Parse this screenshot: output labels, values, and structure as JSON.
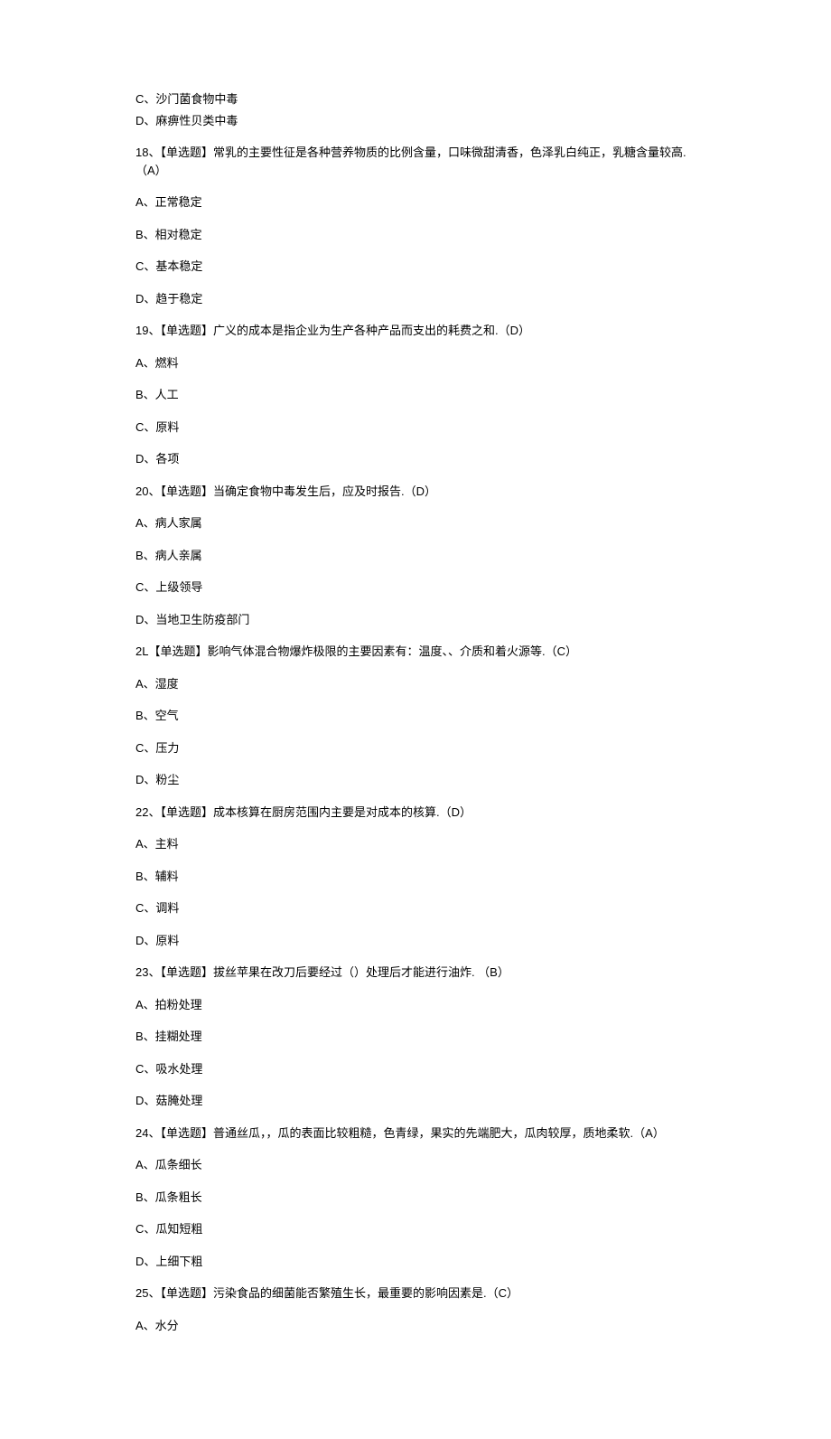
{
  "q17": {
    "optC": "C、沙门菌食物中毒",
    "optD": "D、麻痹性贝类中毒"
  },
  "q18": {
    "text": "18、【单选题】常乳的主要性征是各种营养物质的比例含量，口味微甜清香，色泽乳白纯正，乳糖含量较高.（A）",
    "optA": "A、正常稳定",
    "optB": "B、相对稳定",
    "optC": "C、基本稳定",
    "optD": "D、趋于稳定"
  },
  "q19": {
    "text": "19、【单选题】广义的成本是指企业为生产各种产品而支出的耗费之和.（D）",
    "optA": "A、燃料",
    "optB": "B、人工",
    "optC": "C、原料",
    "optD": "D、各项"
  },
  "q20": {
    "text": "20、【单选题】当确定食物中毒发生后，应及时报告.（D）",
    "optA": "A、病人家属",
    "optB": "B、病人亲属",
    "optC": "C、上级领导",
    "optD": "D、当地卫生防疫部门"
  },
  "q21": {
    "text": "2L【单选题】影响气体混合物爆炸极限的主要因素有：温度、、介质和着火源等.（C）",
    "optA": "A、湿度",
    "optB": "B、空气",
    "optC": "C、压力",
    "optD": "D、粉尘"
  },
  "q22": {
    "text": "22、【单选题】成本核算在厨房范围内主要是对成本的核算.（D）",
    "optA": "A、主料",
    "optB": "B、辅料",
    "optC": "C、调料",
    "optD": "D、原料"
  },
  "q23": {
    "text": "23、【单选题】拔丝苹果在改刀后要经过（）处理后才能进行油炸. （B）",
    "optA": "A、拍粉处理",
    "optB": "B、挂糊处理",
    "optC": "C、吸水处理",
    "optD": "D、菇腌处理"
  },
  "q24": {
    "text": "24、【单选题】普通丝瓜，，瓜的表面比较粗糙，色青绿，果实的先端肥大，瓜肉较厚，质地柔软.（A）",
    "optA": "A、瓜条细长",
    "optB": "B、瓜条粗长",
    "optC": "C、瓜知短粗",
    "optD": "D、上细下粗"
  },
  "q25": {
    "text": "25、【单选题】污染食品的细菌能否繁殖生长，最重要的影响因素是.（C）",
    "optA": "A、水分"
  }
}
